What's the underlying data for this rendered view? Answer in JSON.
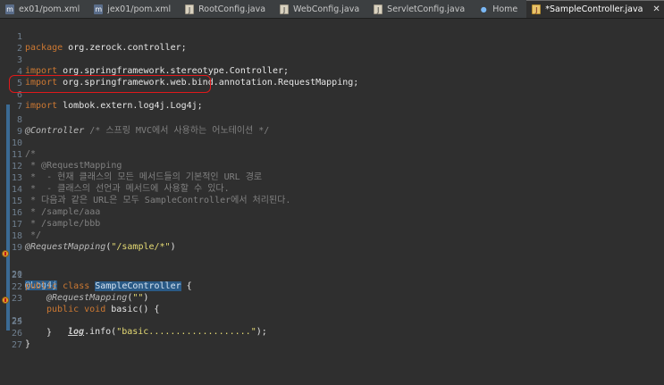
{
  "tabs": [
    {
      "label": "ex01/pom.xml",
      "icon": "xml-file-icon",
      "glyph": "m"
    },
    {
      "label": "jex01/pom.xml",
      "icon": "xml-file-icon",
      "glyph": "m"
    },
    {
      "label": "RootConfig.java",
      "icon": "java-file-icon",
      "glyph": "J"
    },
    {
      "label": "WebConfig.java",
      "icon": "java-file-icon",
      "glyph": "J"
    },
    {
      "label": "ServletConfig.java",
      "icon": "java-file-icon",
      "glyph": "J"
    },
    {
      "label": "Home",
      "icon": "globe-icon",
      "glyph": "●"
    },
    {
      "label": "*SampleController.java",
      "icon": "java-file-icon",
      "glyph": "J",
      "active": true,
      "close": "✕"
    }
  ],
  "editor": {
    "line_numbers": [
      "1",
      "2",
      "3",
      "4",
      "5",
      "6",
      "7",
      "8",
      "9",
      "10",
      "11",
      "12",
      "13",
      "14",
      "15",
      "16",
      "17",
      "18",
      "19",
      "20",
      "21",
      "22",
      "23",
      "24",
      "25",
      "26",
      "27"
    ],
    "lines": {
      "l1_kw": "package",
      "l1_rest": " org.zerock.controller;",
      "l3_kw": "import",
      "l3_rest": " org.springframework.stereotype.Controller;",
      "l4_kw": "import",
      "l4_rest": " org.springframework.web.bind.annotation.RequestMapping;",
      "l6_kw": "import",
      "l6_rest": " lombok.extern.log4j.Log4j;",
      "l8_ann": "@Controller",
      "l8_cm": " /* 스프링 MVC에서 사용하는 어노테이션 */",
      "l10": "/*",
      "l11": " * @RequestMapping",
      "l12": " *  - 현재 클래스의 모든 메서드들의 기본적인 URL 경로",
      "l13": " *  - 클래스의 선언과 메서드에 사용할 수 있다.",
      "l14": " * 다음과 같은 URL은 모두 SampleController에서 처리된다.",
      "l15": " * /sample/aaa",
      "l16": " * /sample/bbb",
      "l17": " */",
      "l18_ann": "@RequestMapping",
      "l18_open": "(",
      "l18_str": "\"/sample/*\"",
      "l18_close": ")",
      "l20_ann": "@Log4j",
      "l21_kw": "public class",
      "l21_sp": " ",
      "l21_cls": "SampleController",
      "l21_rest": " {",
      "l22_ann": "@RequestMapping",
      "l22_open": "(",
      "l22_str": "\"\"",
      "l22_close": ")",
      "l23_kw": "public void",
      "l23_rest": " basic() {",
      "l24_field": "log",
      "l24_mid": ".info(",
      "l24_str": "\"basic...................\"",
      "l24_end": ");",
      "l25": "}",
      "l26": "}"
    }
  }
}
